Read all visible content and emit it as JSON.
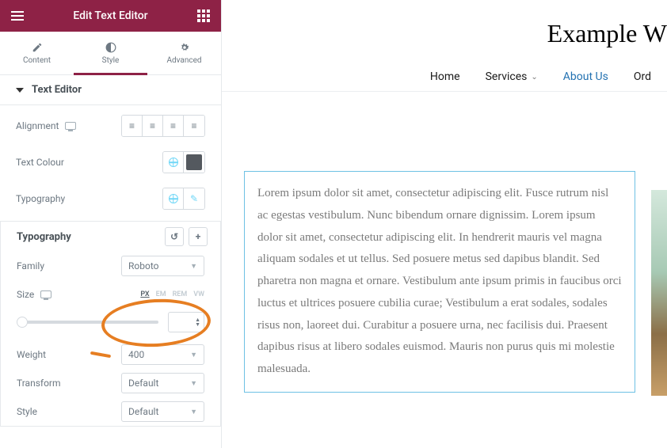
{
  "header": {
    "title": "Edit Text Editor"
  },
  "tabs": {
    "content": "Content",
    "style": "Style",
    "advanced": "Advanced"
  },
  "section": {
    "title": "Text Editor"
  },
  "controls": {
    "alignment_label": "Alignment",
    "text_colour_label": "Text Colour",
    "typography_label": "Typography"
  },
  "typo": {
    "panel_title": "Typography",
    "family_label": "Family",
    "family_value": "Roboto",
    "size_label": "Size",
    "units": {
      "px": "PX",
      "em": "EM",
      "rem": "REM",
      "vw": "VW"
    },
    "weight_label": "Weight",
    "weight_value": "400",
    "transform_label": "Transform",
    "transform_value": "Default",
    "style_label": "Style",
    "style_value": "Default"
  },
  "site": {
    "title": "Example W",
    "nav": {
      "home": "Home",
      "services": "Services",
      "about": "About Us",
      "order": "Ord"
    }
  },
  "body_text": "Lorem ipsum dolor sit amet, consectetur adipiscing elit. Fusce rutrum nisl ac egestas vestibulum. Nunc bibendum ornare dignissim. Lorem ipsum dolor sit amet, consectetur adipiscing elit. In hendrerit mauris vel magna aliquam sodales et ut tellus. Sed posuere metus sed dapibus blandit. Sed pharetra non magna et ornare. Vestibulum ante ipsum primis in faucibus orci luctus et ultrices posuere cubilia curae; Vestibulum a erat sodales, sodales risus non, laoreet dui. Curabitur a posuere urna, nec facilisis dui. Praesent dapibus risus at libero sodales euismod. Mauris non purus quis mi molestie malesuada."
}
